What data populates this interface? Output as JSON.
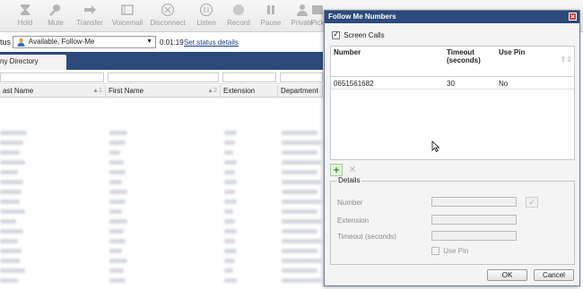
{
  "toolbar": {
    "buttons": [
      {
        "label": "Hold",
        "icon": "hold-icon"
      },
      {
        "label": "Mute",
        "icon": "mute-icon"
      },
      {
        "label": "Transfer",
        "icon": "transfer-icon"
      },
      {
        "label": "Voicemail",
        "icon": "voicemail-icon"
      },
      {
        "label": "Disconnect",
        "icon": "disconnect-icon"
      },
      {
        "label": "Listen",
        "icon": "listen-icon"
      },
      {
        "label": "Record",
        "icon": "record-icon"
      },
      {
        "label": "Pause",
        "icon": "pause-icon"
      },
      {
        "label": "Private",
        "icon": "private-icon"
      },
      {
        "label": "Pick",
        "icon": "pick-icon"
      }
    ]
  },
  "status": {
    "prefix": "tus",
    "selected": "Available, Follow-Me",
    "timer": "0:01:19",
    "set_details_link": "Set status details"
  },
  "tabs": {
    "active": "ny Directory"
  },
  "directory": {
    "columns": [
      "ast Name",
      "First Name",
      "Extension",
      "Department"
    ],
    "sort_indicators": [
      "▲1",
      "▲2"
    ]
  },
  "dialog": {
    "title": "Follow Me Numbers",
    "close_label": "✕",
    "screen_calls_label": "Screen Calls",
    "screen_calls_checked": true,
    "list": {
      "headers": {
        "number": "Number",
        "timeout_line1": "Timeout",
        "timeout_line2": "(seconds)",
        "use_pin": "Use Pin"
      },
      "rows": [
        {
          "number": "0651561682",
          "timeout": "30",
          "use_pin": "No"
        }
      ]
    },
    "add_label": "+",
    "delete_label": "✕",
    "details": {
      "legend": "Details",
      "number_label": "Number",
      "extension_label": "Extension",
      "timeout_label": "Timeout (seconds)",
      "use_pin_label": "Use Pin",
      "apply_label": "✓"
    },
    "ok_label": "OK",
    "cancel_label": "Cancel"
  },
  "colors": {
    "title_bar": "#2c4a7c",
    "close_button": "#c7362b",
    "add_green": "#2f9e1f"
  }
}
